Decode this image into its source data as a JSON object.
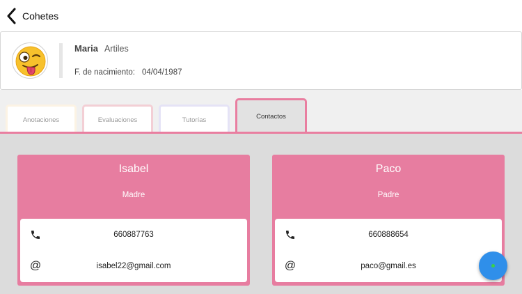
{
  "nav": {
    "back_label": "Cohetes",
    "back_icon": "chevron-left-icon"
  },
  "profile": {
    "avatar_icon": "winking-tongue-emoji",
    "first_name": "Maria",
    "last_name": "Artiles",
    "birth_label": "F. de nacimiento:",
    "birth_value": "04/04/1987"
  },
  "tabs": [
    {
      "label": "Anotaciones",
      "color": "#fcf3e4",
      "active": false
    },
    {
      "label": "Evaluaciones",
      "color": "#f3cfd5",
      "active": false
    },
    {
      "label": "Tutorías",
      "color": "#e5e3f6",
      "active": false
    },
    {
      "label": "Contactos",
      "color": "#e97ea0",
      "active": true
    }
  ],
  "contacts": [
    {
      "name": "Isabel",
      "relation": "Madre",
      "phone": "660887763",
      "email": "isabel22@gmail.com"
    },
    {
      "name": "Paco",
      "relation": "Padre",
      "phone": "660888654",
      "email": "paco@gmail.es"
    }
  ],
  "icons": {
    "phone": "phone-icon",
    "email": "at-sign-icon"
  },
  "colors": {
    "accent_pink": "#e77da0",
    "content_bg": "#dcdcdc",
    "fab_blue": "#2f8fea",
    "fab_dot": "#3ad14a"
  }
}
